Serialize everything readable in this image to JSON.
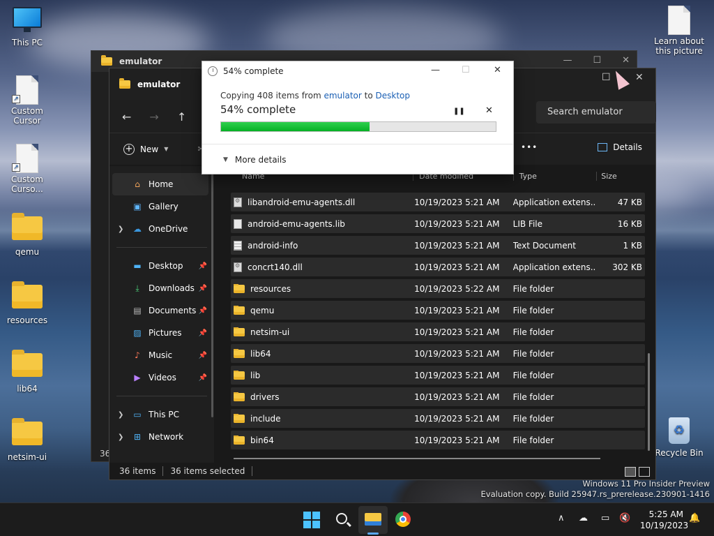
{
  "desktop": {
    "icons": [
      {
        "label": "This PC",
        "kind": "monitor"
      },
      {
        "label": "Custom Cursor",
        "kind": "shortcut-doc"
      },
      {
        "label": "Custom Curso...",
        "kind": "shortcut-doc"
      },
      {
        "label": "qemu",
        "kind": "folder"
      },
      {
        "label": "resources",
        "kind": "folder"
      },
      {
        "label": "lib64",
        "kind": "folder"
      },
      {
        "label": "netsim-ui",
        "kind": "folder"
      }
    ],
    "learn_label": "Learn about this picture",
    "recycle_label": "Recycle Bin"
  },
  "back_window": {
    "title": "emulator",
    "item_count": "36"
  },
  "explorer": {
    "tab_title": "emulator",
    "search_placeholder": "Search emulator",
    "new_label": "New",
    "more_label": "•••",
    "details_label": "Details",
    "sidebar": {
      "home": "Home",
      "gallery": "Gallery",
      "onedrive": "OneDrive",
      "pinned": [
        "Desktop",
        "Downloads",
        "Documents",
        "Pictures",
        "Music",
        "Videos"
      ],
      "this_pc": "This PC",
      "network": "Network"
    },
    "columns": {
      "name": "Name",
      "date": "Date modified",
      "type": "Type",
      "size": "Size"
    },
    "files": [
      {
        "name": "libandroid-emu-agents.dll",
        "date": "10/19/2023 5:21 AM",
        "type": "Application extens...",
        "size": "47 KB",
        "icon": "dll"
      },
      {
        "name": "android-emu-agents.lib",
        "date": "10/19/2023 5:21 AM",
        "type": "LIB File",
        "size": "16 KB",
        "icon": "doc"
      },
      {
        "name": "android-info",
        "date": "10/19/2023 5:21 AM",
        "type": "Text Document",
        "size": "1 KB",
        "icon": "txt"
      },
      {
        "name": "concrt140.dll",
        "date": "10/19/2023 5:21 AM",
        "type": "Application extens...",
        "size": "302 KB",
        "icon": "dll"
      },
      {
        "name": "resources",
        "date": "10/19/2023 5:22 AM",
        "type": "File folder",
        "size": "",
        "icon": "folder"
      },
      {
        "name": "qemu",
        "date": "10/19/2023 5:21 AM",
        "type": "File folder",
        "size": "",
        "icon": "folder"
      },
      {
        "name": "netsim-ui",
        "date": "10/19/2023 5:21 AM",
        "type": "File folder",
        "size": "",
        "icon": "folder"
      },
      {
        "name": "lib64",
        "date": "10/19/2023 5:21 AM",
        "type": "File folder",
        "size": "",
        "icon": "folder"
      },
      {
        "name": "lib",
        "date": "10/19/2023 5:21 AM",
        "type": "File folder",
        "size": "",
        "icon": "folder"
      },
      {
        "name": "drivers",
        "date": "10/19/2023 5:21 AM",
        "type": "File folder",
        "size": "",
        "icon": "folder"
      },
      {
        "name": "include",
        "date": "10/19/2023 5:21 AM",
        "type": "File folder",
        "size": "",
        "icon": "folder"
      },
      {
        "name": "bin64",
        "date": "10/19/2023 5:21 AM",
        "type": "File folder",
        "size": "",
        "icon": "folder"
      }
    ],
    "status": {
      "items": "36 items",
      "selected": "36 items selected"
    }
  },
  "copy_dialog": {
    "title": "54% complete",
    "copy_prefix": "Copying 408 items from ",
    "source": "emulator",
    "to_word": " to ",
    "dest": "Desktop",
    "percent_text": "54% complete",
    "progress": 0.54,
    "more_details": "More details"
  },
  "watermark": {
    "line1": "Windows 11 Pro Insider Preview",
    "line2": "Evaluation copy. Build 25947.rs_prerelease.230901-1416"
  },
  "taskbar": {
    "time": "5:25 AM",
    "date": "10/19/2023"
  },
  "colors": {
    "accent": "#4cc2ff",
    "progress": "#06b025",
    "link": "#1a5fb4",
    "folder": "#f6c843"
  }
}
